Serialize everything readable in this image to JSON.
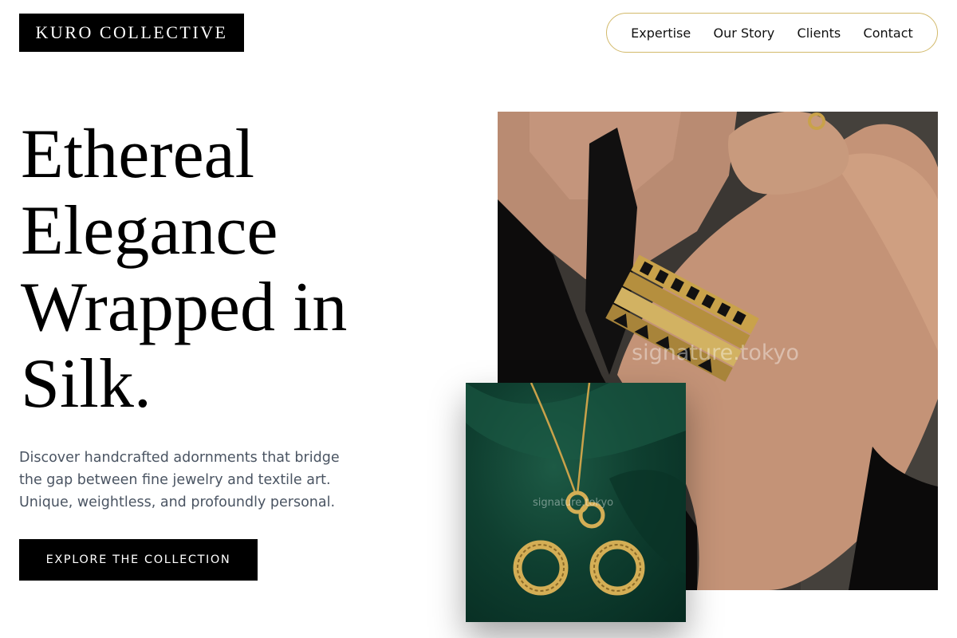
{
  "brand": {
    "logo_text": "KURO COLLECTIVE"
  },
  "nav": {
    "items": [
      {
        "label": "Expertise"
      },
      {
        "label": "Our Story"
      },
      {
        "label": "Clients"
      },
      {
        "label": "Contact"
      }
    ]
  },
  "hero": {
    "headline_lines": [
      "Ethereal",
      "Elegance",
      "Wrapped in",
      "Silk."
    ],
    "description_lines": [
      "Discover handcrafted adornments that bridge",
      "the gap between fine jewelry and textile art.",
      "Unique, weightless, and profoundly personal."
    ],
    "cta_label": "EXPLORE THE COLLECTION"
  },
  "images": {
    "main_watermark": "signature.tokyo",
    "inset_watermark": "signature.tokyo"
  },
  "colors": {
    "accent_gold": "#d2b96a",
    "text_muted": "#4a5462",
    "inset_green": "#0f3f30"
  }
}
